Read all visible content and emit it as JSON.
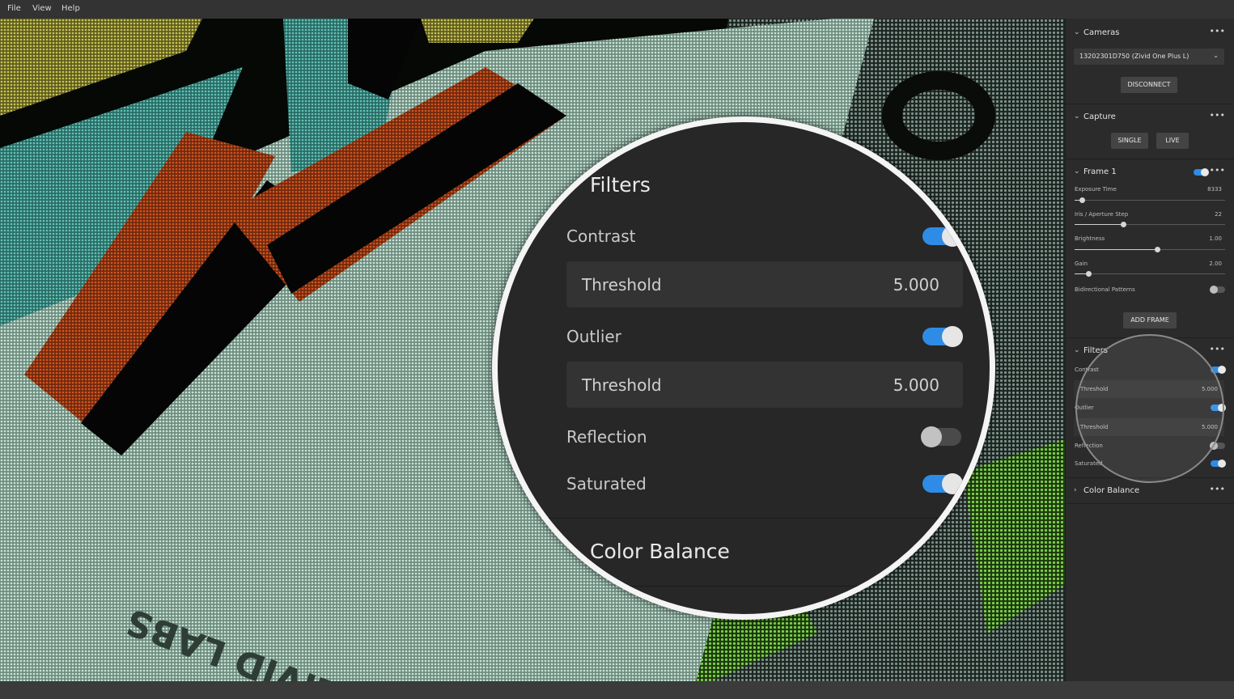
{
  "menu": {
    "items": [
      "File",
      "View",
      "Help"
    ]
  },
  "cameras": {
    "title": "Cameras",
    "selected_camera": "13202301D750 (Zivid One Plus L)",
    "disconnect_label": "DISCONNECT"
  },
  "capture": {
    "title": "Capture",
    "single_label": "SINGLE",
    "live_label": "LIVE"
  },
  "frame1": {
    "title": "Frame 1",
    "enabled": true,
    "settings": [
      {
        "label": "Exposure Time",
        "value": "8333",
        "fraction": 0.05
      },
      {
        "label": "Iris / Aperture Step",
        "value": "22",
        "fraction": 0.32
      },
      {
        "label": "Brightness",
        "value": "1.00",
        "fraction": 0.55
      },
      {
        "label": "Gain",
        "value": "2.00",
        "fraction": 0.09
      }
    ],
    "bidirectional_label": "Bidirectional Patterns",
    "bidirectional_enabled": false,
    "add_frame_label": "ADD FRAME"
  },
  "filters": {
    "title": "Filters",
    "contrast_label": "Contrast",
    "contrast_enabled": true,
    "contrast_threshold_label": "Threshold",
    "contrast_threshold": "5.000",
    "outlier_label": "Outlier",
    "outlier_enabled": true,
    "outlier_threshold_label": "Threshold",
    "outlier_threshold": "5.000",
    "reflection_label": "Reflection",
    "reflection_enabled": false,
    "saturated_label": "Saturated",
    "saturated_enabled": true
  },
  "color_balance": {
    "title": "Color Balance"
  },
  "icons": {
    "expand": "chevron-down-icon",
    "collapsed": "chevron-right-icon",
    "more": "more-icon",
    "dropdown": "dropdown-arrow-icon"
  },
  "viewport": {
    "embossed_text": "ZIVID LABS"
  },
  "colors": {
    "accent": "#2e8ce6",
    "panel_bg": "#2b2b2b"
  }
}
